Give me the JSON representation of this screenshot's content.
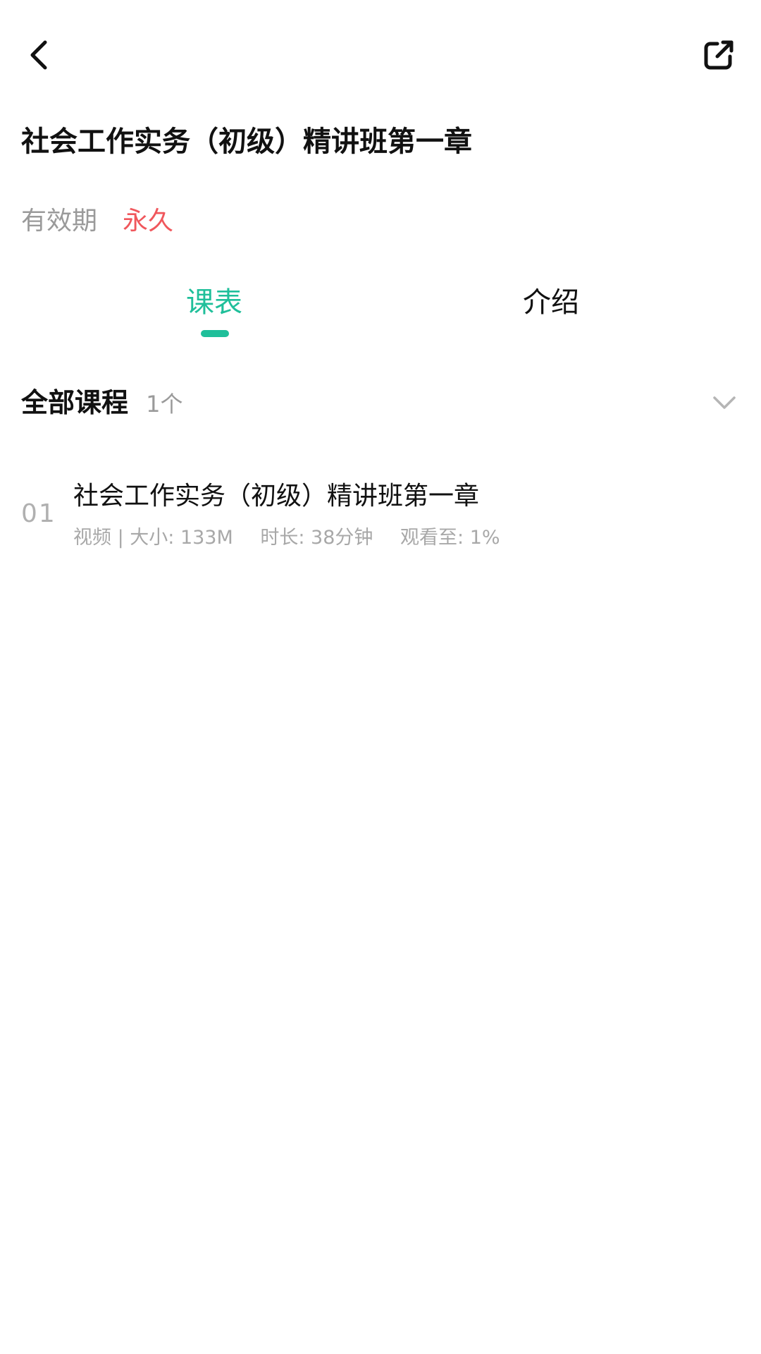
{
  "header": {
    "back_icon": "chevron-left-icon",
    "share_icon": "share-external-icon"
  },
  "course": {
    "title": "社会工作实务（初级）精讲班第一章",
    "validity_label": "有效期",
    "validity_value": "永久"
  },
  "tabs": [
    {
      "label": "课表",
      "active": true
    },
    {
      "label": "介绍",
      "active": false
    }
  ],
  "section": {
    "title": "全部课程",
    "count": "1个",
    "expand_icon": "chevron-down-icon"
  },
  "lessons": [
    {
      "index": "01",
      "title": "社会工作实务（初级）精讲班第一章",
      "type_size": "视频 | 大小: 133M",
      "duration": "时长: 38分钟",
      "progress": "观看至: 1%"
    }
  ],
  "colors": {
    "accent": "#1fbf9a",
    "validity": "#f0575c",
    "muted": "#9a9a9a"
  }
}
